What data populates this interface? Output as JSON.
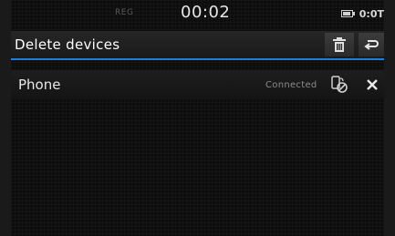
{
  "status": {
    "reg": "REG",
    "time": "00:02",
    "signal_text": "0:0T"
  },
  "header": {
    "title": "Delete devices"
  },
  "devices": [
    {
      "name": "Phone",
      "status": "Connected"
    }
  ],
  "colors": {
    "accent": "#1e7fd8",
    "background": "#0d0d0d"
  },
  "icons": [
    "battery-icon",
    "trash-icon",
    "back-icon",
    "phone-connected-icon",
    "close-icon"
  ]
}
